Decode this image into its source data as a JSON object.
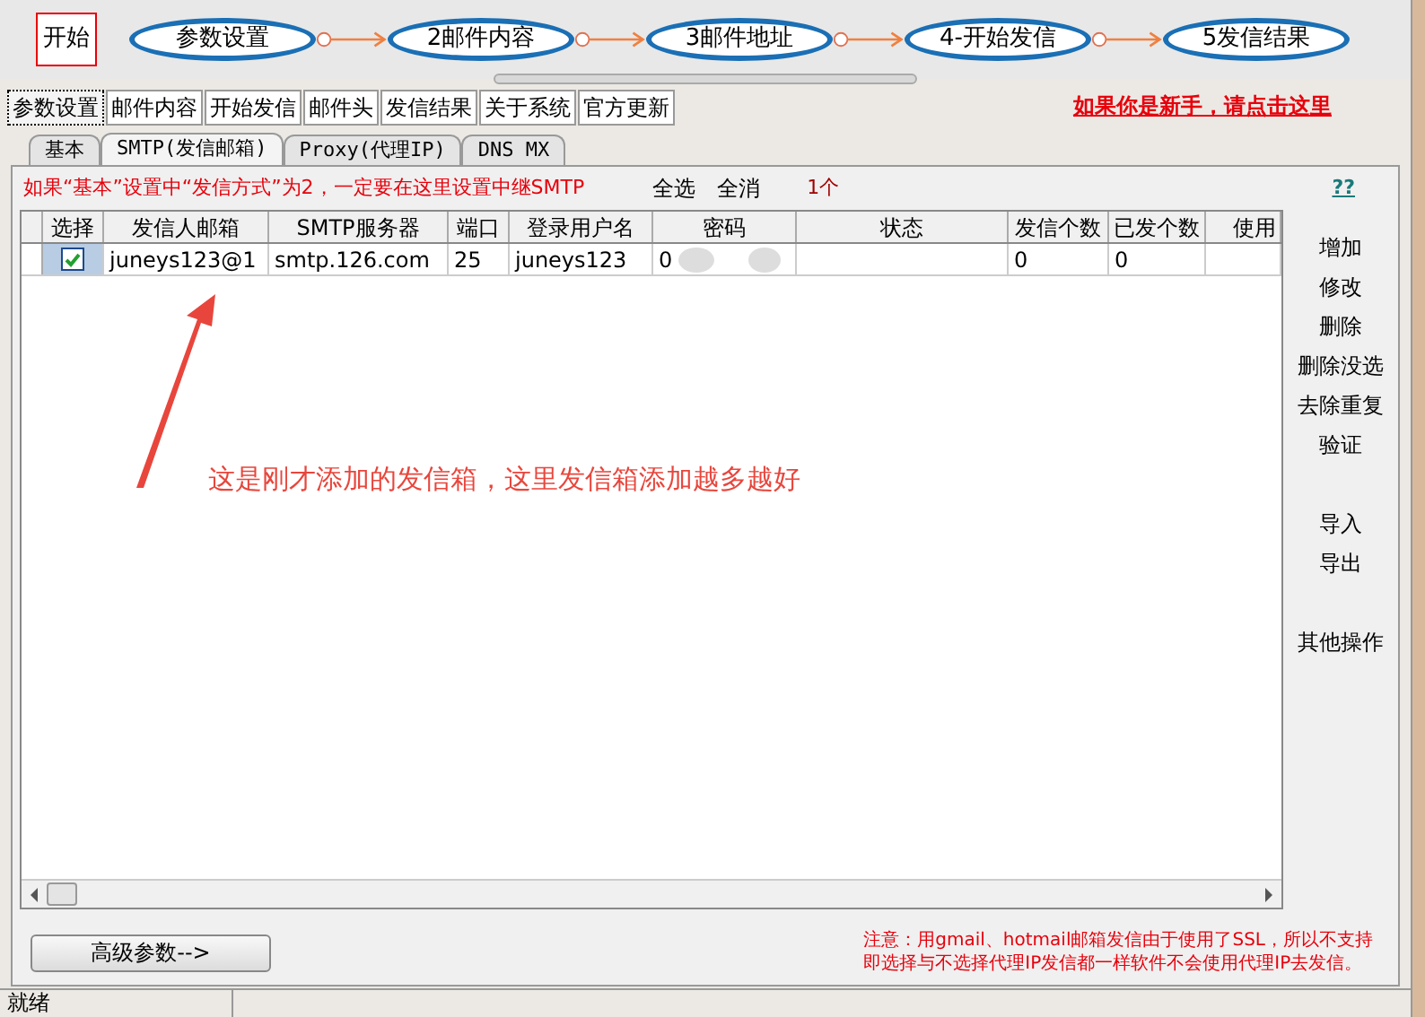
{
  "flow": {
    "start": "开始",
    "steps": [
      "参数设置",
      "2邮件内容",
      "3邮件地址",
      "4-开始发信",
      "5发信结果"
    ]
  },
  "tabs": [
    {
      "label": "参数设置",
      "selected": true
    },
    {
      "label": "邮件内容",
      "selected": false
    },
    {
      "label": "开始发信",
      "selected": false
    },
    {
      "label": "邮件头",
      "selected": false
    },
    {
      "label": "发信结果",
      "selected": false
    },
    {
      "label": "关于系统",
      "selected": false
    },
    {
      "label": "官方更新",
      "selected": false
    }
  ],
  "newbie_link": "如果你是新手，请点击这里",
  "subtabs": [
    {
      "label": "基本",
      "selected": false
    },
    {
      "label": "SMTP(发信邮箱)",
      "selected": true
    },
    {
      "label": "Proxy(代理IP)",
      "selected": false
    },
    {
      "label": "DNS MX",
      "selected": false
    }
  ],
  "hint": "如果“基本”设置中“发信方式”为2，一定要在这里设置中继SMTP",
  "select_all": "全选",
  "deselect_all": "全消",
  "count": "1个",
  "help_link": "??",
  "table": {
    "columns": [
      "选择",
      "发信人邮箱",
      "SMTP服务器",
      "端口",
      "登录用户名",
      "密码",
      "状态",
      "发信个数",
      "已发个数",
      "使用"
    ],
    "rows": [
      {
        "checked": true,
        "email": "juneys123@1",
        "server": "smtp.126.com",
        "port": "25",
        "user": "juneys123",
        "password": "0",
        "sent_quota": "0",
        "sent": "0"
      }
    ]
  },
  "annotation": "这是刚才添加的发信箱，这里发信箱添加越多越好",
  "action_groups": [
    [
      "增加",
      "修改",
      "删除",
      "删除没选",
      "去除重复",
      "验证"
    ],
    [
      "导入",
      "导出"
    ],
    [
      "其他操作"
    ]
  ],
  "advanced_button": "高级参数-->",
  "note": [
    "注意：用gmail、hotmail邮箱发信由于使用了SSL，所以不支持",
    "即选择与不选择代理IP发信都一样软件不会使用代理IP去发信。"
  ],
  "status_bar": [
    "就绪"
  ]
}
